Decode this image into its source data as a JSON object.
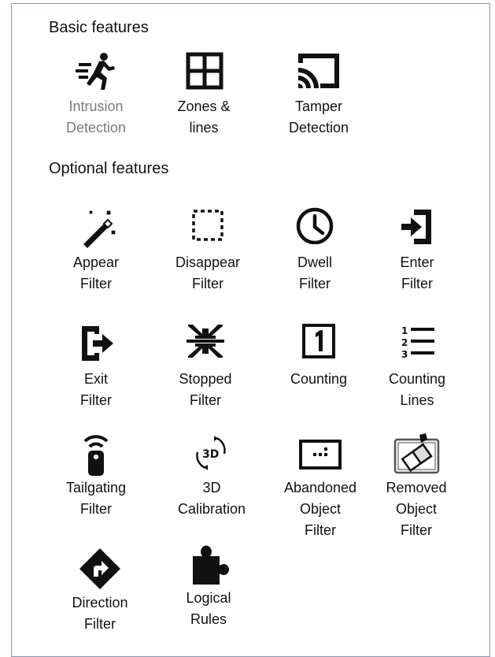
{
  "sections": {
    "basic_title": "Basic features",
    "optional_title": "Optional features"
  },
  "basic": [
    {
      "label": "Intrusion\nDetection",
      "icon": "running-person-icon",
      "muted": true
    },
    {
      "label": "Zones &\nlines",
      "icon": "grid-icon"
    },
    {
      "label": "Tamper\nDetection",
      "icon": "cast-screen-icon"
    }
  ],
  "optional": [
    {
      "label": "Appear\nFilter",
      "icon": "magic-wand-icon"
    },
    {
      "label": "Disappear\nFilter",
      "icon": "dashed-square-icon"
    },
    {
      "label": "Dwell\nFilter",
      "icon": "clock-icon"
    },
    {
      "label": "Enter\nFilter",
      "icon": "sign-in-icon"
    },
    {
      "label": "Exit\nFilter",
      "icon": "sign-out-icon"
    },
    {
      "label": "Stopped\nFilter",
      "icon": "converge-arrows-icon"
    },
    {
      "label": "Counting",
      "icon": "numbered-box-icon"
    },
    {
      "label": "Counting\nLines",
      "icon": "numbered-list-icon"
    },
    {
      "label": "Tailgating\nFilter",
      "icon": "remote-signal-icon"
    },
    {
      "label": "3D\nCalibration",
      "icon": "3d-rotate-icon"
    },
    {
      "label": "Abandoned\nObject\nFilter",
      "icon": "dotted-box-icon"
    },
    {
      "label": "Removed\nObject\nFilter",
      "icon": "eraser-box-icon"
    },
    {
      "label": "Direction\nFilter",
      "icon": "direction-sign-icon"
    },
    {
      "label": "Logical\nRules",
      "icon": "puzzle-piece-icon"
    }
  ],
  "colors": {
    "border": "#7f9ab8",
    "muted_text": "#7a7a7a",
    "icon": "#111111"
  }
}
